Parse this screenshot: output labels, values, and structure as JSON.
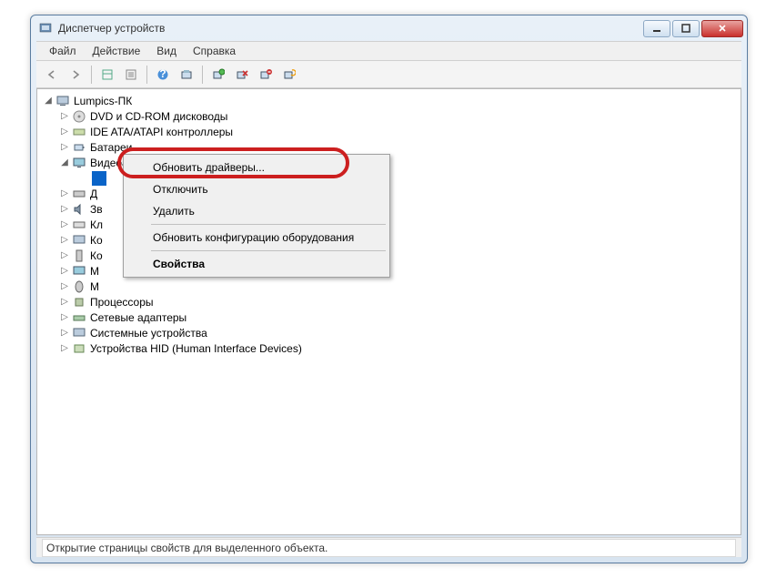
{
  "window": {
    "title": "Диспетчер устройств"
  },
  "menu": {
    "file": "Файл",
    "action": "Действие",
    "view": "Вид",
    "help": "Справка"
  },
  "tree": {
    "root": "Lumpics-ПК",
    "items": [
      {
        "label": "DVD и CD-ROM дисководы",
        "truncated": false
      },
      {
        "label": "IDE ATA/ATAPI контроллеры",
        "truncated": false
      },
      {
        "label": "Батареи",
        "truncated": false
      },
      {
        "label": "Видеоадаптеры",
        "truncated": false,
        "expanded": true
      },
      {
        "label": "Д",
        "truncated": true
      },
      {
        "label": "Зв",
        "truncated": true
      },
      {
        "label": "Кл",
        "truncated": true
      },
      {
        "label": "Ко",
        "truncated": true
      },
      {
        "label": "Ко",
        "truncated": true
      },
      {
        "label": "М",
        "truncated": true
      },
      {
        "label": "М",
        "truncated": true
      },
      {
        "label": "Процессоры",
        "truncated": false
      },
      {
        "label": "Сетевые адаптеры",
        "truncated": false
      },
      {
        "label": "Системные устройства",
        "truncated": false
      },
      {
        "label": "Устройства HID (Human Interface Devices)",
        "truncated": false
      }
    ]
  },
  "context_menu": {
    "update_drivers": "Обновить драйверы...",
    "disable": "Отключить",
    "delete": "Удалить",
    "refresh": "Обновить конфигурацию оборудования",
    "properties": "Свойства"
  },
  "statusbar": {
    "text": "Открытие страницы свойств для выделенного объекта."
  }
}
